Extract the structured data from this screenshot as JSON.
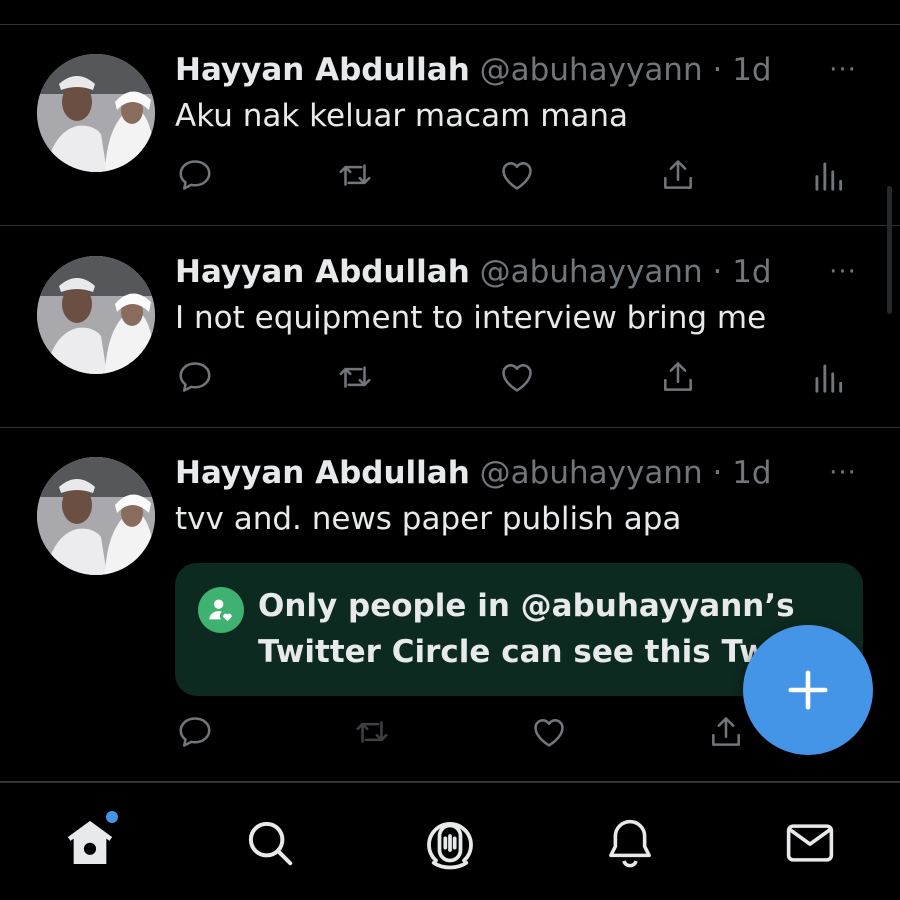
{
  "colors": {
    "background": "#000000",
    "text_primary": "#e7e9ea",
    "text_secondary": "#71767b",
    "accent_blue": "#4494e7",
    "circle_green": "#3fb171",
    "circle_box_bg": "#0d2a20",
    "divider": "#2f3336"
  },
  "tweets": [
    {
      "author_name": "Hayyan Abdullah",
      "handle": "@abuhayyann",
      "separator": "·",
      "time": "1d",
      "more": "···",
      "text": "Aku nak keluar macam mana"
    },
    {
      "author_name": "Hayyan Abdullah",
      "handle": "@abuhayyann",
      "separator": "·",
      "time": "1d",
      "more": "···",
      "text": "I not equipment to interview bring me"
    },
    {
      "author_name": "Hayyan Abdullah",
      "handle": "@abuhayyann",
      "separator": "·",
      "time": "1d",
      "more": "···",
      "text": "tvv and. news paper publish apa",
      "circle_notice": "Only people in @abuhayyann’s Twitter Circle can see this Tweet"
    }
  ],
  "actions": [
    "reply-icon",
    "retweet-icon",
    "like-icon",
    "share-icon",
    "views-icon"
  ],
  "fab": {
    "icon": "plus-icon"
  },
  "bottom_nav": {
    "items": [
      "home-icon",
      "search-icon",
      "spaces-icon",
      "notifications-icon",
      "messages-icon"
    ],
    "home_has_new_badge": true
  }
}
